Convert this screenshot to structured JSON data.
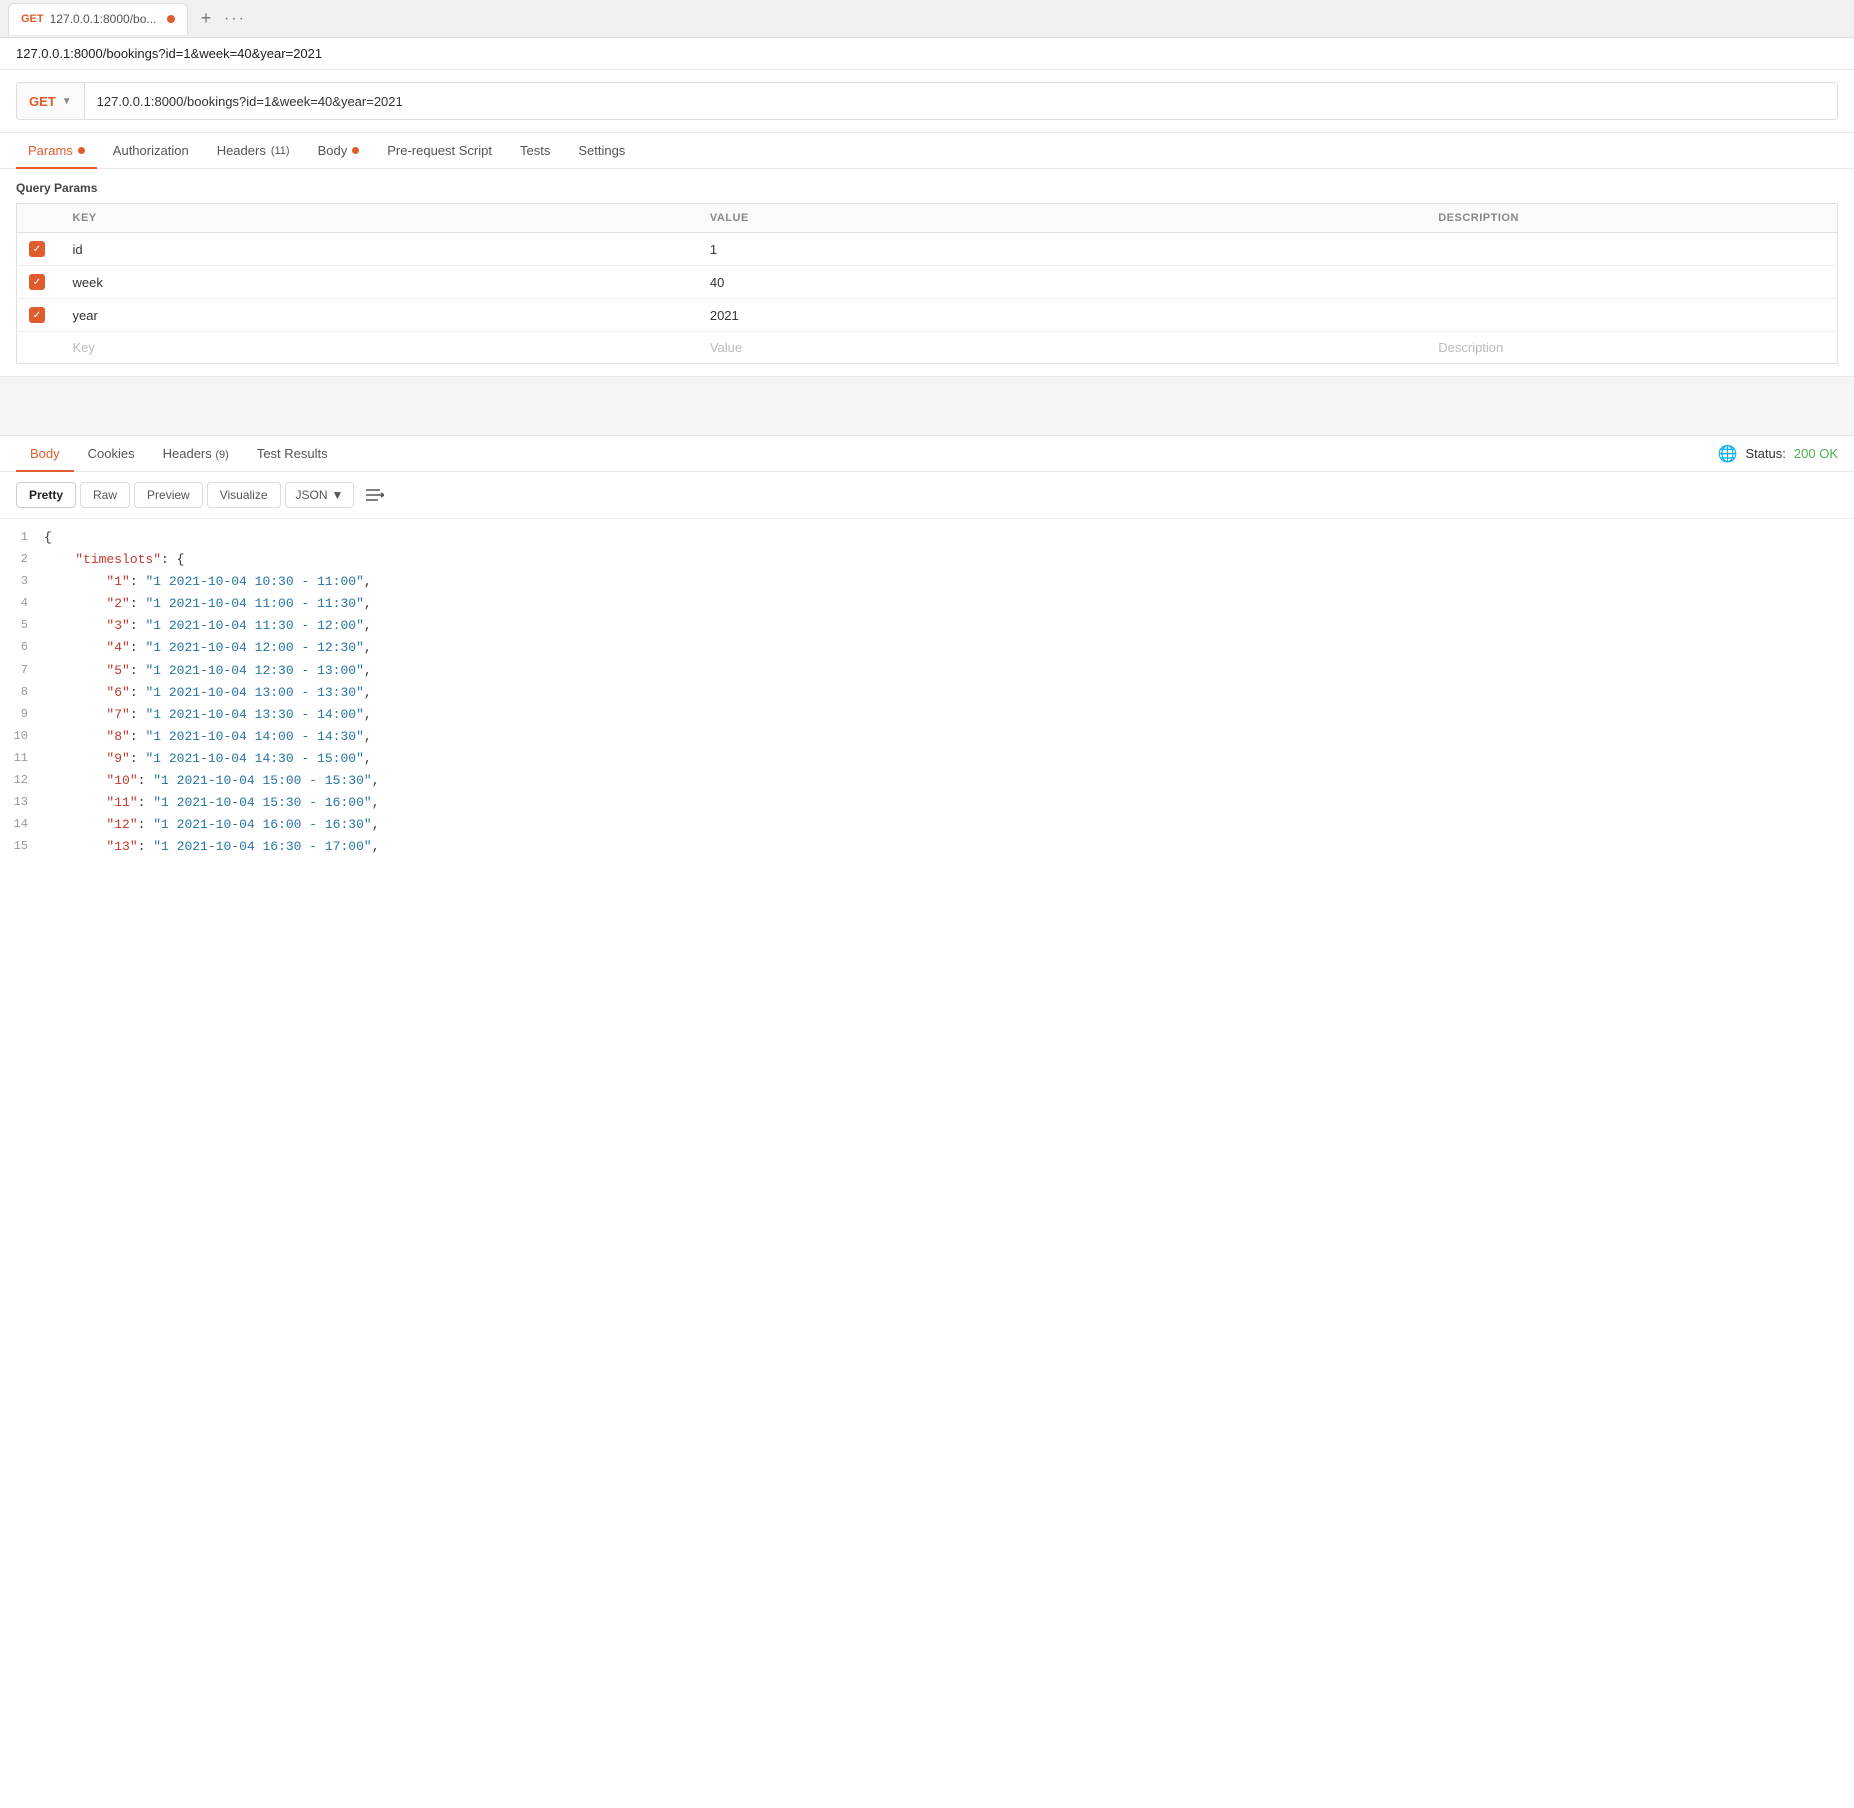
{
  "browser": {
    "tab_method": "GET",
    "tab_url": "127.0.0.1:8000/bo...",
    "tab_dot_color": "#e05c2d",
    "add_tab_label": "+",
    "more_label": "···"
  },
  "address_bar": {
    "url": "127.0.0.1:8000/bookings?id=1&week=40&year=2021"
  },
  "request": {
    "method": "GET",
    "url": "127.0.0.1:8000/bookings?id=1&week=40&year=2021",
    "tabs": [
      {
        "label": "Params",
        "dot": "orange",
        "active": true
      },
      {
        "label": "Authorization",
        "dot": null,
        "active": false
      },
      {
        "label": "Headers",
        "badge": "(11)",
        "dot": null,
        "active": false
      },
      {
        "label": "Body",
        "dot": "orange",
        "active": false
      },
      {
        "label": "Pre-request Script",
        "dot": null,
        "active": false
      },
      {
        "label": "Tests",
        "dot": null,
        "active": false
      },
      {
        "label": "Settings",
        "dot": null,
        "active": false
      }
    ],
    "query_params_title": "Query Params",
    "table_headers": [
      "",
      "KEY",
      "VALUE",
      "DESCRIPTION"
    ],
    "params": [
      {
        "checked": true,
        "key": "id",
        "value": "1",
        "description": ""
      },
      {
        "checked": true,
        "key": "week",
        "value": "40",
        "description": ""
      },
      {
        "checked": true,
        "key": "year",
        "value": "2021",
        "description": ""
      }
    ],
    "new_row": {
      "key": "Key",
      "value": "Value",
      "description": "Description"
    }
  },
  "response": {
    "tabs": [
      {
        "label": "Body",
        "active": true
      },
      {
        "label": "Cookies",
        "active": false
      },
      {
        "label": "Headers",
        "badge": "(9)",
        "active": false
      },
      {
        "label": "Test Results",
        "active": false
      }
    ],
    "status_text": "Status:",
    "status_code": "200 OK",
    "format_buttons": [
      "Pretty",
      "Raw",
      "Preview",
      "Visualize"
    ],
    "active_format": "Pretty",
    "format_type": "JSON",
    "json_lines": [
      {
        "num": 1,
        "content": "{"
      },
      {
        "num": 2,
        "content": "    \"timeslots\": {"
      },
      {
        "num": 3,
        "content": "        \"1\": \"1 2021-10-04 10:30 - 11:00\","
      },
      {
        "num": 4,
        "content": "        \"2\": \"1 2021-10-04 11:00 - 11:30\","
      },
      {
        "num": 5,
        "content": "        \"3\": \"1 2021-10-04 11:30 - 12:00\","
      },
      {
        "num": 6,
        "content": "        \"4\": \"1 2021-10-04 12:00 - 12:30\","
      },
      {
        "num": 7,
        "content": "        \"5\": \"1 2021-10-04 12:30 - 13:00\","
      },
      {
        "num": 8,
        "content": "        \"6\": \"1 2021-10-04 13:00 - 13:30\","
      },
      {
        "num": 9,
        "content": "        \"7\": \"1 2021-10-04 13:30 - 14:00\","
      },
      {
        "num": 10,
        "content": "        \"8\": \"1 2021-10-04 14:00 - 14:30\","
      },
      {
        "num": 11,
        "content": "        \"9\": \"1 2021-10-04 14:30 - 15:00\","
      },
      {
        "num": 12,
        "content": "        \"10\": \"1 2021-10-04 15:00 - 15:30\","
      },
      {
        "num": 13,
        "content": "        \"11\": \"1 2021-10-04 15:30 - 16:00\","
      },
      {
        "num": 14,
        "content": "        \"12\": \"1 2021-10-04 16:00 - 16:30\","
      },
      {
        "num": 15,
        "content": "        \"13\": \"1 2021-10-04 16:30 - 17:00\","
      }
    ]
  }
}
